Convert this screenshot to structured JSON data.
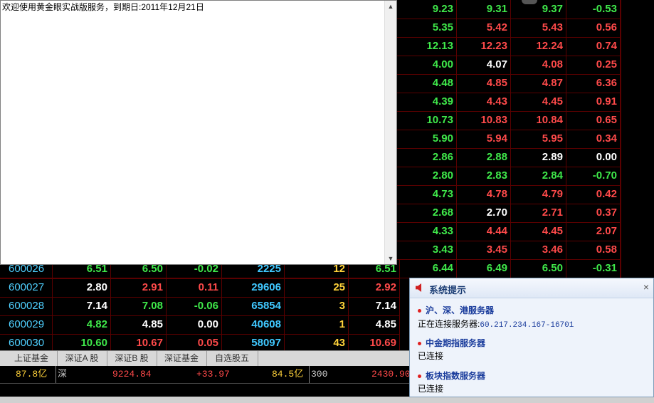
{
  "welcome": {
    "message": "欢迎使用黄金眼实战版服务，到期日:2011年12月21日"
  },
  "right_rows": [
    {
      "v": [
        "9.23",
        "9.31",
        "9.37",
        "-0.53"
      ],
      "c": [
        "green",
        "green",
        "green",
        "green"
      ]
    },
    {
      "v": [
        "5.35",
        "5.42",
        "5.43",
        "0.56"
      ],
      "c": [
        "green",
        "red",
        "red",
        "red"
      ]
    },
    {
      "v": [
        "12.13",
        "12.23",
        "12.24",
        "0.74"
      ],
      "c": [
        "green",
        "red",
        "red",
        "red"
      ]
    },
    {
      "v": [
        "4.00",
        "4.07",
        "4.08",
        "0.25"
      ],
      "c": [
        "green",
        "white",
        "red",
        "red"
      ]
    },
    {
      "v": [
        "4.48",
        "4.85",
        "4.87",
        "6.36"
      ],
      "c": [
        "green",
        "red",
        "red",
        "red"
      ]
    },
    {
      "v": [
        "4.39",
        "4.43",
        "4.45",
        "0.91"
      ],
      "c": [
        "green",
        "red",
        "red",
        "red"
      ]
    },
    {
      "v": [
        "10.73",
        "10.83",
        "10.84",
        "0.65"
      ],
      "c": [
        "green",
        "red",
        "red",
        "red"
      ]
    },
    {
      "v": [
        "5.90",
        "5.94",
        "5.95",
        "0.34"
      ],
      "c": [
        "green",
        "red",
        "red",
        "red"
      ]
    },
    {
      "v": [
        "2.86",
        "2.88",
        "2.89",
        "0.00"
      ],
      "c": [
        "green",
        "green",
        "white",
        "white"
      ]
    },
    {
      "v": [
        "2.80",
        "2.83",
        "2.84",
        "-0.70"
      ],
      "c": [
        "green",
        "green",
        "green",
        "green"
      ]
    },
    {
      "v": [
        "4.73",
        "4.78",
        "4.79",
        "0.42"
      ],
      "c": [
        "green",
        "red",
        "red",
        "red"
      ]
    },
    {
      "v": [
        "2.68",
        "2.70",
        "2.71",
        "0.37"
      ],
      "c": [
        "green",
        "white",
        "red",
        "red"
      ]
    },
    {
      "v": [
        "4.33",
        "4.44",
        "4.45",
        "2.07"
      ],
      "c": [
        "green",
        "red",
        "red",
        "red"
      ]
    },
    {
      "v": [
        "3.43",
        "3.45",
        "3.46",
        "0.58"
      ],
      "c": [
        "green",
        "red",
        "red",
        "red"
      ]
    },
    {
      "v": [
        "6.44",
        "6.49",
        "6.50",
        "-0.31"
      ],
      "c": [
        "green",
        "green",
        "green",
        "green"
      ]
    }
  ],
  "stock_rows": [
    {
      "code": "600026",
      "v": [
        "6.51",
        "6.50",
        "-0.02",
        "2225",
        "12",
        "6.51"
      ],
      "c": [
        "green",
        "green",
        "green",
        "",
        "",
        "green"
      ]
    },
    {
      "code": "600027",
      "v": [
        "2.80",
        "2.91",
        "0.11",
        "29606",
        "25",
        "2.92"
      ],
      "c": [
        "white",
        "red",
        "red",
        "",
        "",
        "red"
      ]
    },
    {
      "code": "600028",
      "v": [
        "7.14",
        "7.08",
        "-0.06",
        "65854",
        "3",
        "7.14"
      ],
      "c": [
        "white",
        "green",
        "green",
        "",
        "",
        "white"
      ]
    },
    {
      "code": "600029",
      "v": [
        "4.82",
        "4.85",
        "0.00",
        "40608",
        "1",
        "4.85"
      ],
      "c": [
        "green",
        "white",
        "white",
        "",
        "",
        "white"
      ]
    },
    {
      "code": "600030",
      "v": [
        "10.60",
        "10.67",
        "0.05",
        "58097",
        "43",
        "10.69"
      ],
      "c": [
        "green",
        "red",
        "red",
        "",
        "",
        "red"
      ]
    }
  ],
  "tabs": [
    "上证基金",
    "深证A 股",
    "深证B 股",
    "深证基金",
    "自选股五"
  ],
  "index_bar": {
    "amount1": "87.8亿",
    "market1": "深",
    "value1": "9224.84",
    "change1": "+33.97",
    "amount2": "84.5亿",
    "market2": "300",
    "value2": "2430.90"
  },
  "system_panel": {
    "title": "系统提示",
    "close": "×",
    "sections": [
      {
        "title": "沪、深、港服务器",
        "status": "正在连接服务器:",
        "ip": "60.217.234.167-16701"
      },
      {
        "title": "中金期指服务器",
        "status": "已连接",
        "ip": ""
      },
      {
        "title": "板块指数服务器",
        "status": "已连接",
        "ip": ""
      }
    ]
  },
  "colors": {
    "green": "#3fe84a",
    "red": "#ff4a4a",
    "white": "#ffffff",
    "code": "#4fd0ff",
    "volume": "#40c8ff",
    "count": "#ffd23a"
  }
}
